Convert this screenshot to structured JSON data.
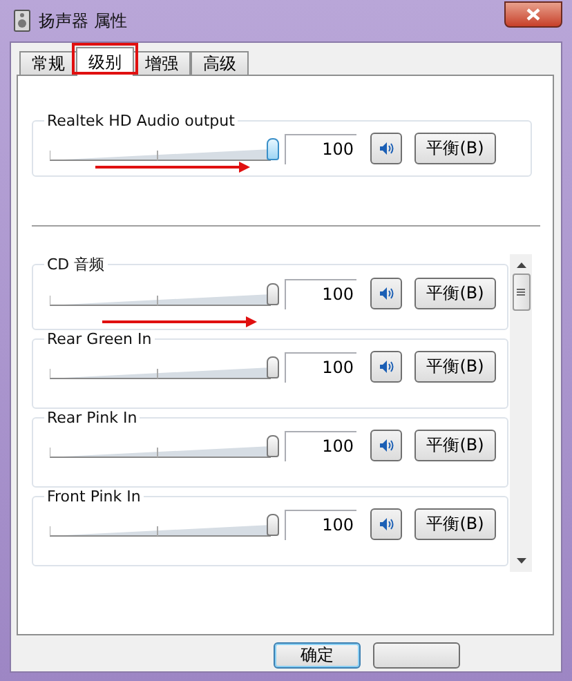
{
  "window": {
    "title": "扬声器 属性"
  },
  "tabs": [
    {
      "label": "常规",
      "selected": false
    },
    {
      "label": "级别",
      "selected": true
    },
    {
      "label": "增强",
      "selected": false
    },
    {
      "label": "高级",
      "selected": false
    }
  ],
  "master": {
    "name": "Realtek HD Audio output",
    "level": 1,
    "value": "100",
    "muted": false,
    "balance": "平衡(B)"
  },
  "channels": [
    {
      "name": "CD 音频",
      "level": 1,
      "value": "100",
      "muted": false,
      "balance": "平衡(B)"
    },
    {
      "name": "Rear Green In",
      "level": 1,
      "value": "100",
      "muted": false,
      "balance": "平衡(B)"
    },
    {
      "name": "Rear Pink In",
      "level": 1,
      "value": "100",
      "muted": false,
      "balance": "平衡(B)"
    },
    {
      "name": "Front Pink In",
      "level": 1,
      "value": "100",
      "muted": false,
      "balance": "平衡(B)"
    }
  ],
  "dialog_buttons": [
    "确定"
  ]
}
